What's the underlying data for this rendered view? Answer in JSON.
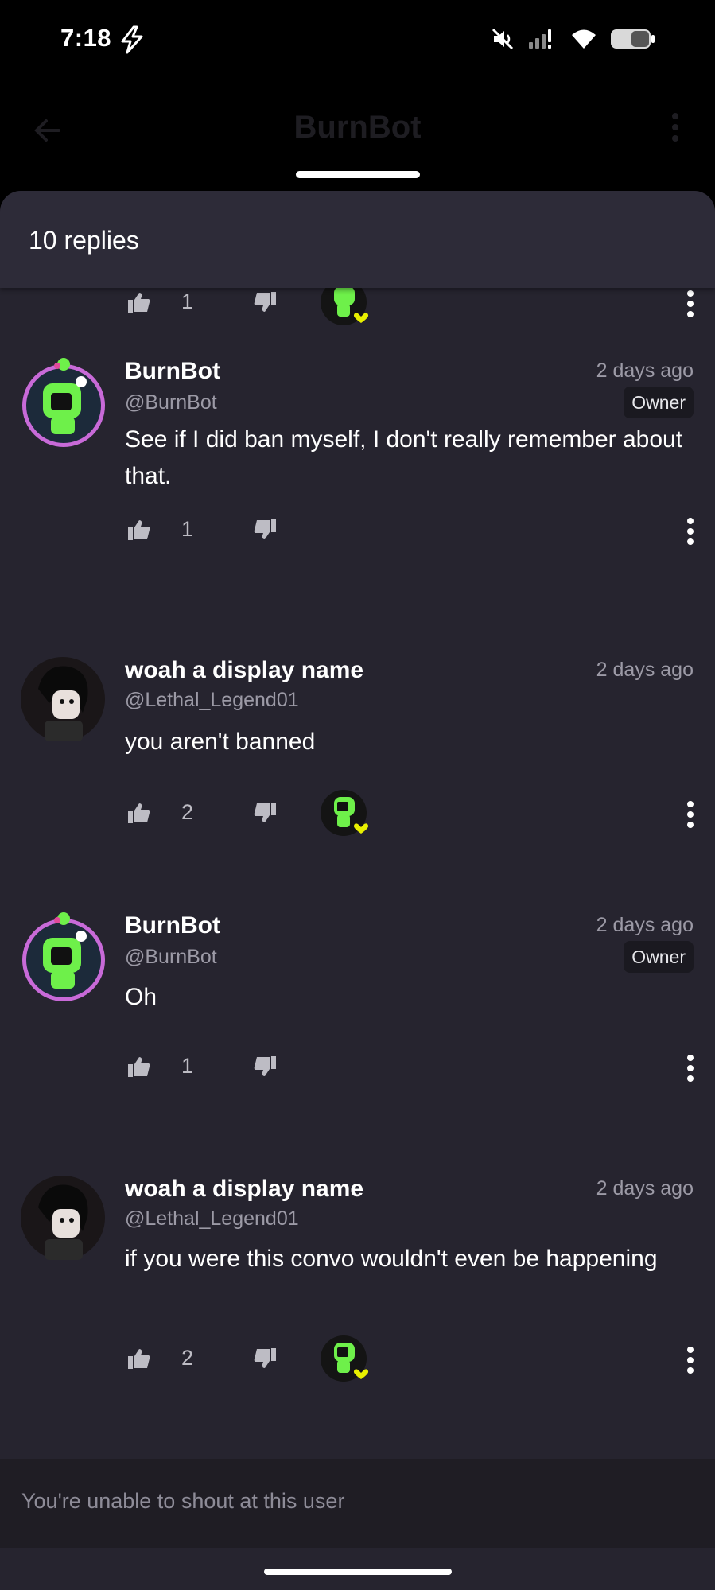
{
  "status_bar": {
    "time": "7:18",
    "icons": [
      "bolt-icon",
      "mute-icon",
      "signal-icon",
      "wifi-icon",
      "battery-icon"
    ]
  },
  "app_header": {
    "title": "BurnBot",
    "icons": [
      "back-arrow-icon",
      "more-vertical-icon"
    ]
  },
  "sheet": {
    "replies_count": "10 replies"
  },
  "partial_reply": {
    "like_count": "1"
  },
  "replies": [
    {
      "name": "BurnBot",
      "handle": "@BurnBot",
      "time": "2 days ago",
      "badge": "Owner",
      "body": "See if I did ban myself, I don't really remember about that.",
      "likes": "1",
      "creator_heart": false
    },
    {
      "name": "woah a display name",
      "handle": "@Lethal_Legend01",
      "time": "2 days ago",
      "body": "you aren't banned",
      "likes": "2",
      "creator_heart": true
    },
    {
      "name": "BurnBot",
      "handle": "@BurnBot",
      "time": "2 days ago",
      "badge": "Owner",
      "body": "Oh",
      "likes": "1",
      "creator_heart": false
    },
    {
      "name": "woah a display name",
      "handle": "@Lethal_Legend01",
      "time": "2 days ago",
      "body": "if you were this convo wouldn't even be happening",
      "likes": "2",
      "creator_heart": true
    }
  ],
  "composer": {
    "placeholder": "You're unable to shout at this user"
  },
  "colors": {
    "sheet_bg": "#26242f",
    "header_bg": "#2d2b38",
    "accent_green": "#6ef04a",
    "heart_yellow": "#e8f000",
    "owner_ring": "#c86ad8"
  }
}
